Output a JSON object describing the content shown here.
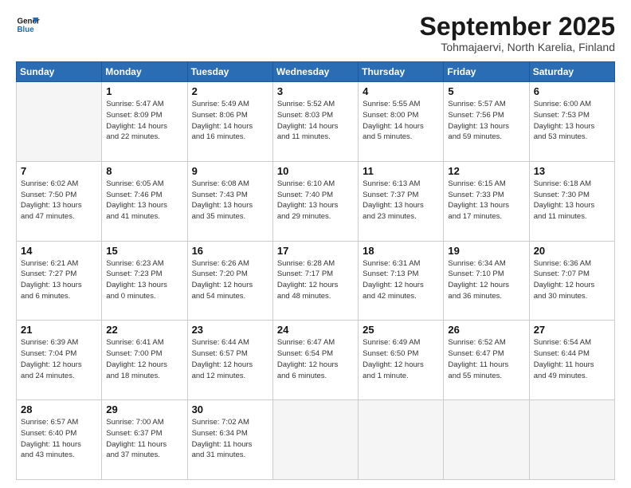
{
  "header": {
    "logo_line1": "General",
    "logo_line2": "Blue",
    "title": "September 2025",
    "subtitle": "Tohmajaervi, North Karelia, Finland"
  },
  "weekdays": [
    "Sunday",
    "Monday",
    "Tuesday",
    "Wednesday",
    "Thursday",
    "Friday",
    "Saturday"
  ],
  "weeks": [
    [
      {
        "day": "",
        "info": ""
      },
      {
        "day": "1",
        "info": "Sunrise: 5:47 AM\nSunset: 8:09 PM\nDaylight: 14 hours\nand 22 minutes."
      },
      {
        "day": "2",
        "info": "Sunrise: 5:49 AM\nSunset: 8:06 PM\nDaylight: 14 hours\nand 16 minutes."
      },
      {
        "day": "3",
        "info": "Sunrise: 5:52 AM\nSunset: 8:03 PM\nDaylight: 14 hours\nand 11 minutes."
      },
      {
        "day": "4",
        "info": "Sunrise: 5:55 AM\nSunset: 8:00 PM\nDaylight: 14 hours\nand 5 minutes."
      },
      {
        "day": "5",
        "info": "Sunrise: 5:57 AM\nSunset: 7:56 PM\nDaylight: 13 hours\nand 59 minutes."
      },
      {
        "day": "6",
        "info": "Sunrise: 6:00 AM\nSunset: 7:53 PM\nDaylight: 13 hours\nand 53 minutes."
      }
    ],
    [
      {
        "day": "7",
        "info": "Sunrise: 6:02 AM\nSunset: 7:50 PM\nDaylight: 13 hours\nand 47 minutes."
      },
      {
        "day": "8",
        "info": "Sunrise: 6:05 AM\nSunset: 7:46 PM\nDaylight: 13 hours\nand 41 minutes."
      },
      {
        "day": "9",
        "info": "Sunrise: 6:08 AM\nSunset: 7:43 PM\nDaylight: 13 hours\nand 35 minutes."
      },
      {
        "day": "10",
        "info": "Sunrise: 6:10 AM\nSunset: 7:40 PM\nDaylight: 13 hours\nand 29 minutes."
      },
      {
        "day": "11",
        "info": "Sunrise: 6:13 AM\nSunset: 7:37 PM\nDaylight: 13 hours\nand 23 minutes."
      },
      {
        "day": "12",
        "info": "Sunrise: 6:15 AM\nSunset: 7:33 PM\nDaylight: 13 hours\nand 17 minutes."
      },
      {
        "day": "13",
        "info": "Sunrise: 6:18 AM\nSunset: 7:30 PM\nDaylight: 13 hours\nand 11 minutes."
      }
    ],
    [
      {
        "day": "14",
        "info": "Sunrise: 6:21 AM\nSunset: 7:27 PM\nDaylight: 13 hours\nand 6 minutes."
      },
      {
        "day": "15",
        "info": "Sunrise: 6:23 AM\nSunset: 7:23 PM\nDaylight: 13 hours\nand 0 minutes."
      },
      {
        "day": "16",
        "info": "Sunrise: 6:26 AM\nSunset: 7:20 PM\nDaylight: 12 hours\nand 54 minutes."
      },
      {
        "day": "17",
        "info": "Sunrise: 6:28 AM\nSunset: 7:17 PM\nDaylight: 12 hours\nand 48 minutes."
      },
      {
        "day": "18",
        "info": "Sunrise: 6:31 AM\nSunset: 7:13 PM\nDaylight: 12 hours\nand 42 minutes."
      },
      {
        "day": "19",
        "info": "Sunrise: 6:34 AM\nSunset: 7:10 PM\nDaylight: 12 hours\nand 36 minutes."
      },
      {
        "day": "20",
        "info": "Sunrise: 6:36 AM\nSunset: 7:07 PM\nDaylight: 12 hours\nand 30 minutes."
      }
    ],
    [
      {
        "day": "21",
        "info": "Sunrise: 6:39 AM\nSunset: 7:04 PM\nDaylight: 12 hours\nand 24 minutes."
      },
      {
        "day": "22",
        "info": "Sunrise: 6:41 AM\nSunset: 7:00 PM\nDaylight: 12 hours\nand 18 minutes."
      },
      {
        "day": "23",
        "info": "Sunrise: 6:44 AM\nSunset: 6:57 PM\nDaylight: 12 hours\nand 12 minutes."
      },
      {
        "day": "24",
        "info": "Sunrise: 6:47 AM\nSunset: 6:54 PM\nDaylight: 12 hours\nand 6 minutes."
      },
      {
        "day": "25",
        "info": "Sunrise: 6:49 AM\nSunset: 6:50 PM\nDaylight: 12 hours\nand 1 minute."
      },
      {
        "day": "26",
        "info": "Sunrise: 6:52 AM\nSunset: 6:47 PM\nDaylight: 11 hours\nand 55 minutes."
      },
      {
        "day": "27",
        "info": "Sunrise: 6:54 AM\nSunset: 6:44 PM\nDaylight: 11 hours\nand 49 minutes."
      }
    ],
    [
      {
        "day": "28",
        "info": "Sunrise: 6:57 AM\nSunset: 6:40 PM\nDaylight: 11 hours\nand 43 minutes."
      },
      {
        "day": "29",
        "info": "Sunrise: 7:00 AM\nSunset: 6:37 PM\nDaylight: 11 hours\nand 37 minutes."
      },
      {
        "day": "30",
        "info": "Sunrise: 7:02 AM\nSunset: 6:34 PM\nDaylight: 11 hours\nand 31 minutes."
      },
      {
        "day": "",
        "info": ""
      },
      {
        "day": "",
        "info": ""
      },
      {
        "day": "",
        "info": ""
      },
      {
        "day": "",
        "info": ""
      }
    ]
  ]
}
